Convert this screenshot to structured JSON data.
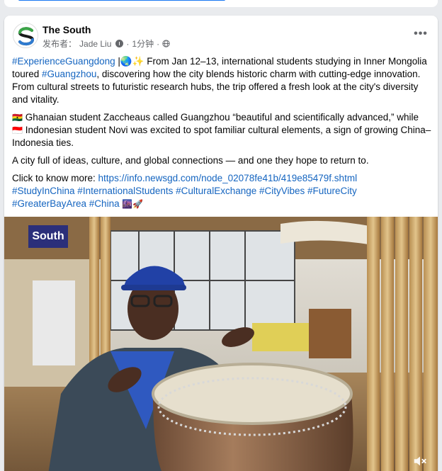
{
  "page": {
    "name": "The South",
    "publisher_prefix": "发布者：",
    "publisher": "Jade Liu",
    "time": "1分钟",
    "separator": "·",
    "more_label": "•••"
  },
  "post": {
    "paragraph1": {
      "tag1": "#ExperienceGuangdong",
      "text1": " |🌏✨ From Jan 12–13, international students studying in Inner Mongolia toured ",
      "tag2": "#Guangzhou",
      "text2": ", discovering how the city blends historic charm with cutting-edge innovation. From cultural streets to futuristic research hubs, the trip offered a fresh look at the city's diversity and vitality."
    },
    "paragraph2": {
      "flag1": "🇬🇭",
      "text1": " Ghanaian student Zaccheaus called Guangzhou “beautiful and scientifically advanced,” while ",
      "flag2": "🇮🇩",
      "text2": " Indonesian student Novi was excited to spot familiar cultural elements, a sign of growing China–Indonesia ties."
    },
    "paragraph3": "A city full of ideas, culture, and global connections — and one they hope to return to.",
    "paragraph4": {
      "prefix": "Click to know more: ",
      "link": "https://info.newsgd.com/node_02078fe41b/419e85479f.shtml",
      "hashtags_line1": "#StudyInChina #InternationalStudents #CulturalExchange #CityVibes #FutureCity",
      "hashtags_line2": "#GreaterBayArea #China",
      "trailing_emoji": " 🌆🚀"
    }
  },
  "video": {
    "badge": "South",
    "mute_icon": "speaker-muted-icon"
  },
  "colors": {
    "accent": "#1877f2",
    "link": "#1565c0",
    "secondary_text": "#65676b"
  }
}
